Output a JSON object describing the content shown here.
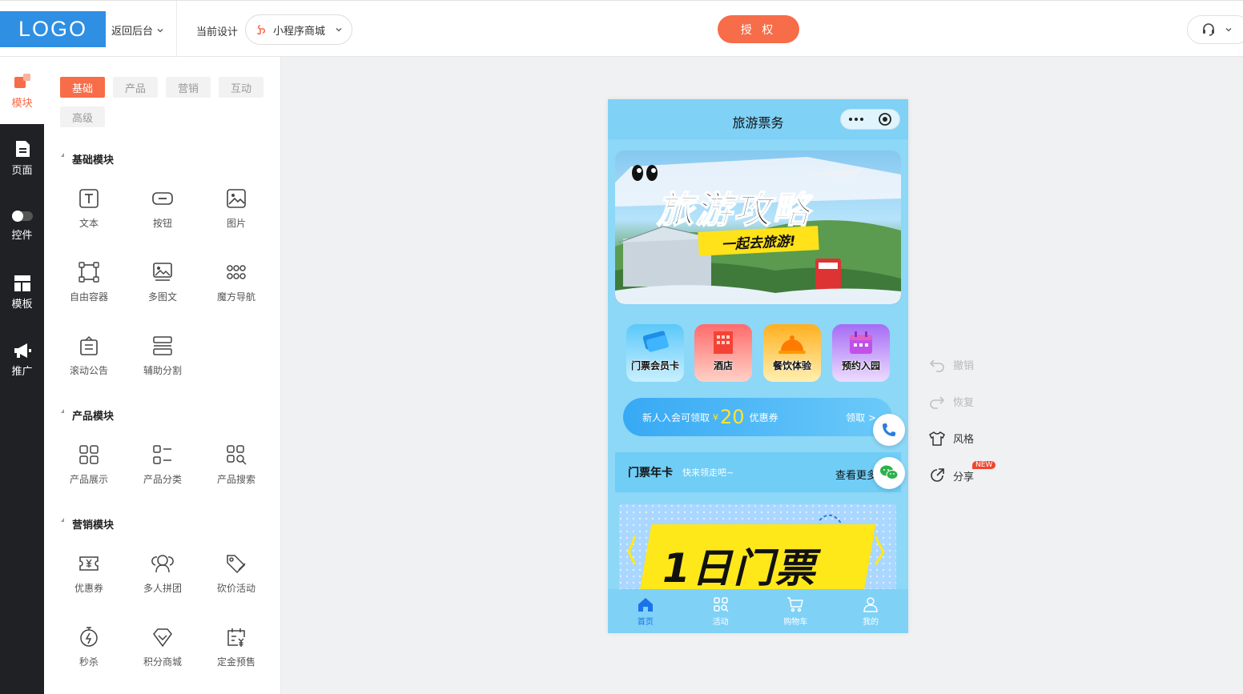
{
  "header": {
    "logo": "LOGO",
    "back_label": "返回后台",
    "current_design_label": "当前设计",
    "design_select": "小程序商城",
    "auth_button": "授 权"
  },
  "leftnav": {
    "items": [
      {
        "label": "模块",
        "icon": "module-icon",
        "active": true
      },
      {
        "label": "页面",
        "icon": "page-icon",
        "active": false
      },
      {
        "label": "控件",
        "icon": "toggle-icon",
        "active": false
      },
      {
        "label": "模板",
        "icon": "template-icon",
        "active": false
      },
      {
        "label": "推广",
        "icon": "megaphone-icon",
        "active": false
      }
    ]
  },
  "panel": {
    "tabs": [
      "基础",
      "产品",
      "营销",
      "互动",
      "高级"
    ],
    "active_tab": "基础",
    "sections": [
      {
        "title": "基础模块",
        "items": [
          "文本",
          "按钮",
          "图片",
          "自由容器",
          "多图文",
          "魔方导航",
          "滚动公告",
          "辅助分割"
        ]
      },
      {
        "title": "产品模块",
        "items": [
          "产品展示",
          "产品分类",
          "产品搜索"
        ]
      },
      {
        "title": "营销模块",
        "items": [
          "优惠券",
          "多人拼团",
          "砍价活动",
          "秒杀",
          "积分商城",
          "定金预售"
        ]
      }
    ]
  },
  "phone": {
    "title": "旅游票务",
    "banner_title": "旅游攻略",
    "banner_sub": "一起去旅游!",
    "icons": [
      {
        "label": "门票会员卡",
        "color_from": "#5ac8fa",
        "color_to": "#b3ebff"
      },
      {
        "label": "酒店",
        "color_from": "#ff6b6b",
        "color_to": "#ffc2b8"
      },
      {
        "label": "餐饮体验",
        "color_from": "#ffb020",
        "color_to": "#ffe89a"
      },
      {
        "label": "预约入园",
        "color_from": "#a56cf5",
        "color_to": "#e3ccff"
      }
    ],
    "coupon": {
      "prefix": "新人入会可领取",
      "yen": "¥",
      "amount": "20",
      "suffix": "优惠券",
      "claim": "领取 >"
    },
    "card_bar": {
      "title": "门票年卡",
      "subtitle": "快来领走吧~",
      "more": "查看更多"
    },
    "ticket_text": "1日门票",
    "tabbar": [
      {
        "label": "首页",
        "icon": "home-icon",
        "active": true
      },
      {
        "label": "活动",
        "icon": "grid-search-icon",
        "active": false
      },
      {
        "label": "购物车",
        "icon": "cart-icon",
        "active": false
      },
      {
        "label": "我的",
        "icon": "user-icon",
        "active": false
      }
    ]
  },
  "tools": {
    "undo": "撤销",
    "redo": "恢复",
    "style": "风格",
    "share": "分享",
    "new_badge": "NEW"
  },
  "colors": {
    "accent": "#f76c49",
    "logo_bg": "#2f8fe3",
    "phone_bg": "#8dd7f7",
    "nav_bg": "#1f2124"
  }
}
